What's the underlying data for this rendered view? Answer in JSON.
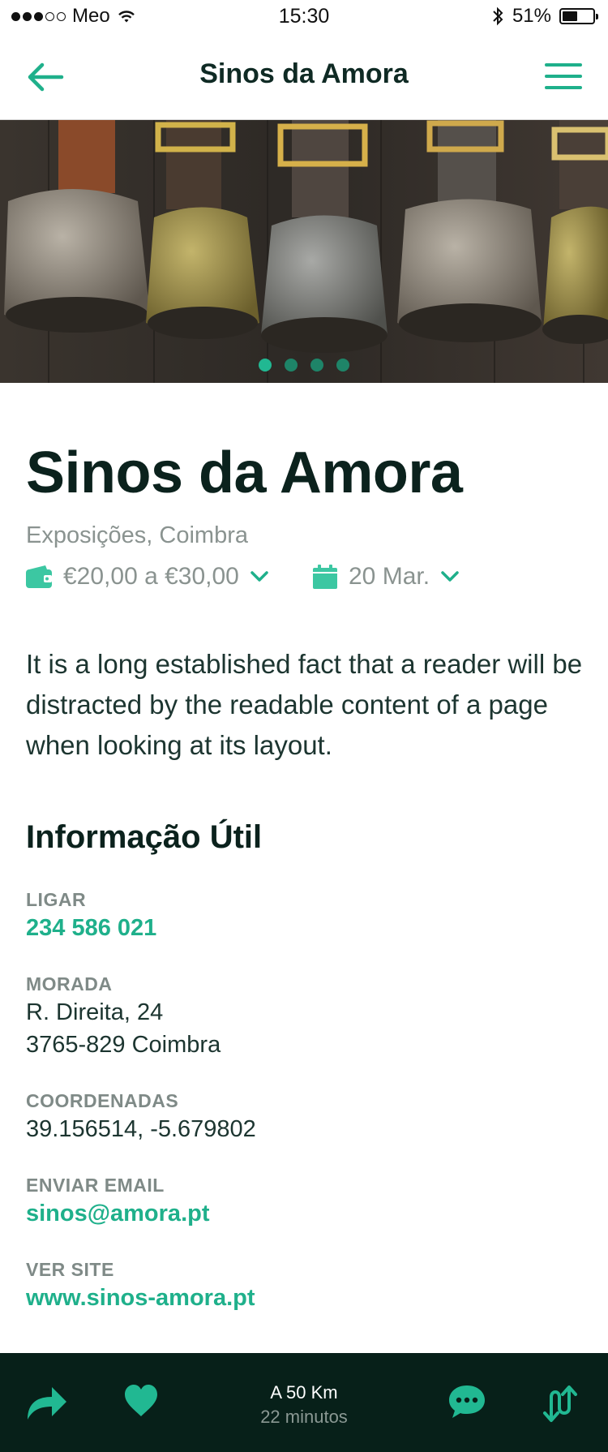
{
  "status_bar": {
    "carrier": "Meo",
    "signal_strength": 3,
    "signal_max": 5,
    "time": "15:30",
    "battery_percent": "51%",
    "battery_level": 0.51,
    "icons": [
      "wifi-icon",
      "bluetooth-icon",
      "battery-icon"
    ]
  },
  "nav": {
    "title": "Sinos da Amora",
    "back_icon": "arrow-left-icon",
    "menu_icon": "hamburger-menu-icon"
  },
  "gallery": {
    "image_count": 4,
    "active_index": 0
  },
  "event": {
    "title": "Sinos da Amora",
    "category": "Exposições, Coimbra",
    "price": "€20,00 a €30,00",
    "date": "20 Mar.",
    "description": "It is a long established fact that a reader will be distracted by the readable content of a page when looking at its layout."
  },
  "info": {
    "section_title": "Informação Útil",
    "call_label": "LIGAR",
    "call_value": "234 586 021",
    "address_label": "MORADA",
    "address_line1": "R. Direita, 24",
    "address_line2": "3765-829 Coimbra",
    "coords_label": "COORDENADAS",
    "coords_value": "39.156514, -5.679802",
    "email_label": "ENVIAR EMAIL",
    "email_value": "sinos@amora.pt",
    "site_label": "VER SITE",
    "site_value": "www.sinos-amora.pt"
  },
  "bottom_bar": {
    "distance": "A 50 Km",
    "duration": "22 minutos",
    "icons": [
      "share-icon",
      "heart-icon",
      "chat-icon",
      "route-icon"
    ]
  },
  "colors": {
    "accent": "#1fb08b",
    "dark": "#072019",
    "text": "#1c3530",
    "muted": "#8a9390"
  }
}
